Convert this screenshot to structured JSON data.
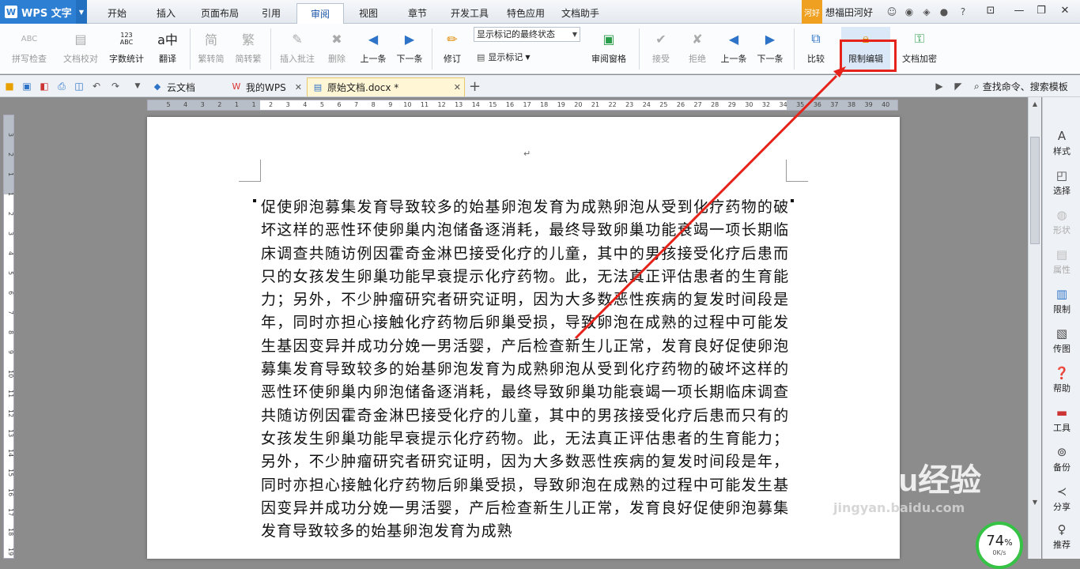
{
  "app": {
    "name": "WPS 文字"
  },
  "menu_tabs": [
    "开始",
    "插入",
    "页面布局",
    "引用",
    "审阅",
    "视图",
    "章节",
    "开发工具",
    "特色应用",
    "文档助手"
  ],
  "user": {
    "badge": "河好",
    "name": "想福田河好"
  },
  "ribbon": {
    "spellcheck": "拼写检查",
    "doc_proof": "文档校对",
    "word_count": "字数统计",
    "translate": "翻译",
    "to_simplified": "繁转简",
    "to_traditional": "简转繁",
    "insert_comment": "插入批注",
    "delete_comment": "删除",
    "prev_comment": "上一条",
    "next_comment": "下一条",
    "revise": "修订",
    "display_mode": "显示标记的最终状态",
    "show_marks": "显示标记",
    "review_pane": "审阅窗格",
    "accept": "接受",
    "reject": "拒绝",
    "prev_change": "上一条",
    "next_change": "下一条",
    "compare": "比较",
    "restrict_edit": "限制编辑",
    "doc_encrypt": "文档加密",
    "icons": {
      "word_count_icon": "123 ABC",
      "spell_icon": "ABC"
    }
  },
  "tabs": [
    {
      "label": "云文档"
    },
    {
      "label": "我的WPS"
    },
    {
      "label": "原始文档.docx *"
    }
  ],
  "search_cmd": "查找命令、搜索模板",
  "hruler_marks": [
    "5",
    "4",
    "3",
    "2",
    "1",
    "1",
    "2",
    "3",
    "4",
    "5",
    "6",
    "7",
    "8",
    "9",
    "10",
    "11",
    "12",
    "13",
    "14",
    "15",
    "16",
    "17",
    "18",
    "19",
    "20",
    "21",
    "22",
    "23",
    "24",
    "25",
    "26",
    "27",
    "28",
    "29",
    "30",
    "32",
    "34",
    "35",
    "36",
    "37",
    "38",
    "39",
    "40"
  ],
  "vruler_marks": [
    "3",
    "2",
    "1",
    "1",
    "2",
    "3",
    "4",
    "5",
    "6",
    "7",
    "8",
    "9",
    "10",
    "11",
    "12",
    "13",
    "14",
    "15",
    "16",
    "17",
    "18",
    "19"
  ],
  "document": {
    "paragraph_mark": "↵",
    "body": "促使卵泡募集发育导致较多的始基卵泡发育为成熟卵泡从受到化疗药物的破坏这样的恶性环使卵巢内泡储备逐消耗，最终导致卵巢功能衰竭一项长期临床调查共随访例因霍奇金淋巴接受化疗的儿童，其中的男孩接受化疗后患而只的女孩发生卵巢功能早衰提示化疗药物。此，无法真正评估患者的生育能力；另外，不少肿瘤研究者研究证明，因为大多数恶性疾病的复发时间段是年，同时亦担心接触化疗药物后卵巢受损，导致卵泡在成熟的过程中可能发生基因变异并成功分娩一男活婴，产后检查新生儿正常，发育良好促使卵泡募集发育导致较多的始基卵泡发育为成熟卵泡从受到化疗药物的破坏这样的恶性环使卵巢内卵泡储备逐消耗，最终导致卵巢功能衰竭一项长期临床调查共随访例因霍奇金淋巴接受化疗的儿童，其中的男孩接受化疗后患而只有的女孩发生卵巢功能早衰提示化疗药物。此，无法真正评估患者的生育能力；另外，不少肿瘤研究者研究证明，因为大多数恶性疾病的复发时间段是年，同时亦担心接触化疗药物后卵巢受损，导致卵泡在成熟的过程中可能发生基因变异并成功分娩一男活婴，产后检查新生儿正常，发育良好促使卵泡募集发育导致较多的始基卵泡发育为成熟"
  },
  "right_panel": [
    "样式",
    "选择",
    "形状",
    "属性",
    "限制",
    "传图",
    "帮助",
    "工具",
    "备份",
    "分享",
    "推荐"
  ],
  "zoom": {
    "value": "74",
    "unit": "%",
    "speed": "0K/s"
  },
  "watermark": {
    "brand": "Baidu经验",
    "url": "jingyan.baidu.com"
  },
  "colors": {
    "accent": "#2d7fd3",
    "highlight": "#e5231a",
    "zoom_ring": "#35c245"
  }
}
